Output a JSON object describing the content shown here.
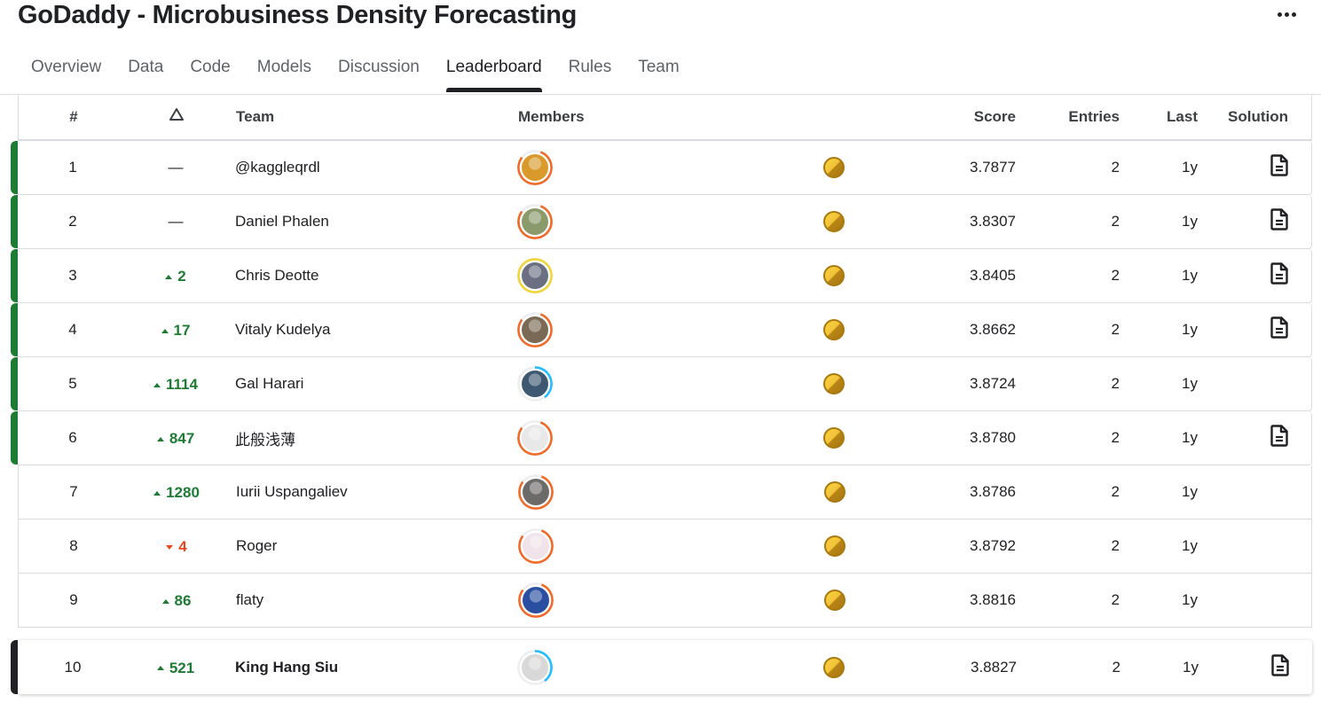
{
  "header": {
    "title": "GoDaddy - Microbusiness Density Forecasting",
    "more_icon": "more-horizontal-icon"
  },
  "tabs": [
    {
      "label": "Overview",
      "active": false
    },
    {
      "label": "Data",
      "active": false
    },
    {
      "label": "Code",
      "active": false
    },
    {
      "label": "Models",
      "active": false
    },
    {
      "label": "Discussion",
      "active": false
    },
    {
      "label": "Leaderboard",
      "active": true
    },
    {
      "label": "Rules",
      "active": false
    },
    {
      "label": "Team",
      "active": false
    }
  ],
  "table": {
    "columns": {
      "rank": "#",
      "delta": "Δ",
      "team": "Team",
      "members": "Members",
      "score": "Score",
      "entries": "Entries",
      "last": "Last",
      "solution": "Solution"
    },
    "rows": [
      {
        "rank": "1",
        "delta": "—",
        "delta_dir": "none",
        "team": "@kaggleqrdl",
        "avatar_ring": "#f06a2a",
        "avatar_ring_pct": 80,
        "avatar_bg": "#d99a2b",
        "medal": "gold",
        "score": "3.7877",
        "entries": "2",
        "last": "1y",
        "solution": true,
        "in_medal_zone": true
      },
      {
        "rank": "2",
        "delta": "—",
        "delta_dir": "none",
        "team": "Daniel Phalen",
        "avatar_ring": "#f06a2a",
        "avatar_ring_pct": 80,
        "avatar_bg": "#8a9a6a",
        "medal": "gold",
        "score": "3.8307",
        "entries": "2",
        "last": "1y",
        "solution": true,
        "in_medal_zone": true
      },
      {
        "rank": "3",
        "delta": "2",
        "delta_dir": "up",
        "team": "Chris Deotte",
        "avatar_ring": "#f0d43a",
        "avatar_ring_pct": 100,
        "avatar_bg": "#6a6f82",
        "medal": "gold",
        "score": "3.8405",
        "entries": "2",
        "last": "1y",
        "solution": true,
        "in_medal_zone": true
      },
      {
        "rank": "4",
        "delta": "17",
        "delta_dir": "up",
        "team": "Vitaly Kudelya",
        "avatar_ring": "#f06a2a",
        "avatar_ring_pct": 80,
        "avatar_bg": "#7a6a55",
        "medal": "gold",
        "score": "3.8662",
        "entries": "2",
        "last": "1y",
        "solution": true,
        "in_medal_zone": true
      },
      {
        "rank": "5",
        "delta": "1114",
        "delta_dir": "up",
        "team": "Gal Harari",
        "avatar_ring": "#20beff",
        "avatar_ring_pct": 40,
        "avatar_bg": "#3d5870",
        "medal": "gold",
        "score": "3.8724",
        "entries": "2",
        "last": "1y",
        "solution": false,
        "in_medal_zone": true
      },
      {
        "rank": "6",
        "delta": "847",
        "delta_dir": "up",
        "team": "此般浅薄",
        "avatar_ring": "#f06a2a",
        "avatar_ring_pct": 80,
        "avatar_bg": "#e8e8e8",
        "medal": "gold",
        "score": "3.8780",
        "entries": "2",
        "last": "1y",
        "solution": true,
        "in_medal_zone": true
      },
      {
        "rank": "7",
        "delta": "1280",
        "delta_dir": "up",
        "team": "Iurii Uspangaliev",
        "avatar_ring": "#f06a2a",
        "avatar_ring_pct": 80,
        "avatar_bg": "#6d6a6a",
        "medal": "gold",
        "score": "3.8786",
        "entries": "2",
        "last": "1y",
        "solution": false,
        "in_medal_zone": false
      },
      {
        "rank": "8",
        "delta": "4",
        "delta_dir": "down",
        "team": "Roger",
        "avatar_ring": "#f06a2a",
        "avatar_ring_pct": 80,
        "avatar_bg": "#f1e3ea",
        "medal": "gold",
        "score": "3.8792",
        "entries": "2",
        "last": "1y",
        "solution": false,
        "in_medal_zone": false
      },
      {
        "rank": "9",
        "delta": "86",
        "delta_dir": "up",
        "team": "flaty",
        "avatar_ring": "#f06a2a",
        "avatar_ring_pct": 80,
        "avatar_bg": "#2a4ea0",
        "medal": "gold",
        "score": "3.8816",
        "entries": "2",
        "last": "1y",
        "solution": false,
        "in_medal_zone": false
      }
    ],
    "user_row": {
      "rank": "10",
      "delta": "521",
      "delta_dir": "up",
      "team": "King Hang Siu",
      "avatar_ring": "#20beff",
      "avatar_ring_pct": 40,
      "avatar_bg": "#d8d8d8",
      "medal": "gold",
      "score": "3.8827",
      "entries": "2",
      "last": "1y",
      "solution": true
    }
  },
  "colors": {
    "medal_zone": "#1e7b34",
    "up": "#1e7b34",
    "down": "#e8481c",
    "gold": "#f2c23a"
  }
}
